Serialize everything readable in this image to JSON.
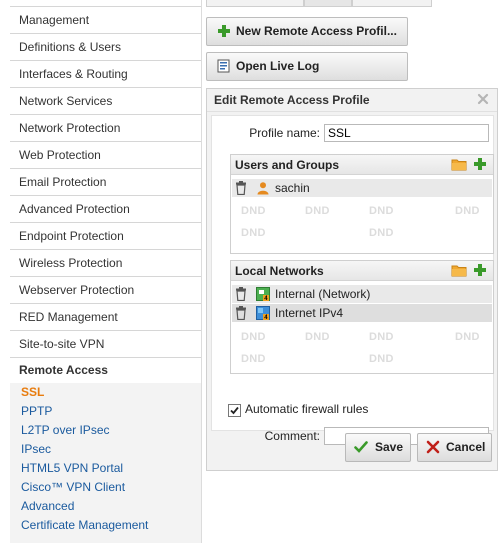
{
  "sidebar": {
    "items": [
      {
        "label": "Management"
      },
      {
        "label": "Definitions & Users"
      },
      {
        "label": "Interfaces & Routing"
      },
      {
        "label": "Network Services"
      },
      {
        "label": "Network Protection"
      },
      {
        "label": "Web Protection"
      },
      {
        "label": "Email Protection"
      },
      {
        "label": "Advanced Protection"
      },
      {
        "label": "Endpoint Protection"
      },
      {
        "label": "Wireless Protection"
      },
      {
        "label": "Webserver Protection"
      },
      {
        "label": "RED Management"
      },
      {
        "label": "Site-to-site VPN"
      }
    ],
    "section_title": "Remote Access",
    "subitems": [
      {
        "label": "SSL",
        "active": true
      },
      {
        "label": "PPTP"
      },
      {
        "label": "L2TP over IPsec"
      },
      {
        "label": "IPsec"
      },
      {
        "label": "HTML5 VPN Portal"
      },
      {
        "label": "Cisco™ VPN Client"
      },
      {
        "label": "Advanced"
      },
      {
        "label": "Certificate Management"
      }
    ]
  },
  "actions": {
    "new_profile_label": "New Remote Access Profil...",
    "open_log_label": "Open Live Log"
  },
  "dialog": {
    "title": "Edit Remote Access Profile",
    "profile_name_label": "Profile name:",
    "profile_name_value": "SSL",
    "users_groups": {
      "title": "Users and Groups",
      "entries": [
        {
          "label": "sachin",
          "icon": "user-icon"
        }
      ]
    },
    "local_networks": {
      "title": "Local Networks",
      "entries": [
        {
          "label": "Internal (Network)",
          "icon": "network-icon"
        },
        {
          "label": "Internet IPv4",
          "icon": "internet-icon"
        }
      ]
    },
    "dnd_text": "DND",
    "firewall_rules_label": "Automatic firewall rules",
    "firewall_rules_checked": true,
    "comment_label": "Comment:",
    "comment_value": "",
    "save_label": "Save",
    "cancel_label": "Cancel"
  },
  "colors": {
    "accent_orange": "#e87c0e",
    "link_blue": "#1a5a9e",
    "plus_green": "#3a9a2a",
    "cancel_red": "#c0201a"
  }
}
